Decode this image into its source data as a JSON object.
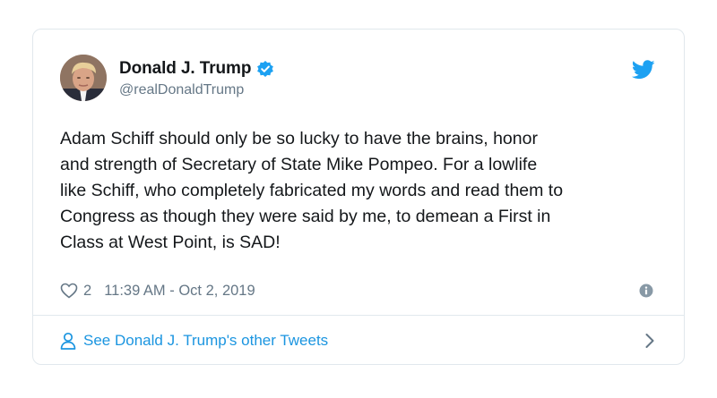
{
  "tweet": {
    "display_name": "Donald J. Trump",
    "handle": "@realDonaldTrump",
    "verified": true,
    "text": "Adam Schiff should only be so lucky to have the brains, honor\nand strength of Secretary of State Mike Pompeo. For a lowlife\nlike Schiff, who completely fabricated my words and read them to\nCongress as though they were said by me, to demean a First in\nClass at West Point, is SAD!",
    "likes": "2",
    "timestamp": "11:39 AM - Oct 2, 2019"
  },
  "footer": {
    "link_label": "See Donald J. Trump's other Tweets"
  },
  "icons": {
    "verified": "verified-badge-icon",
    "brand": "twitter-bird-icon",
    "like": "heart-icon",
    "info": "info-icon",
    "person": "person-icon",
    "chevron": "chevron-right-icon"
  },
  "colors": {
    "twitter_blue": "#1da1f2",
    "link_blue": "#1b95e0",
    "secondary_text": "#657786",
    "border": "#e1e8ed"
  }
}
